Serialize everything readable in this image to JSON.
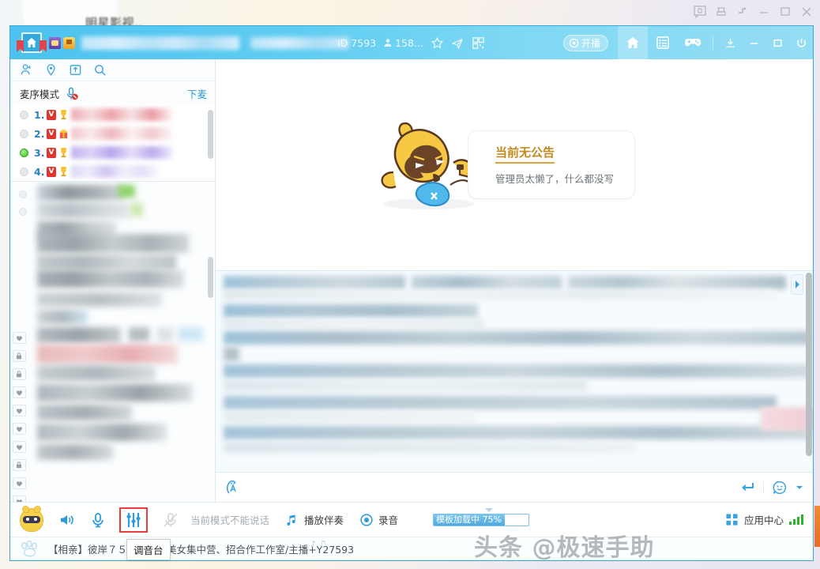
{
  "desktop": {
    "background_title": "明星影视..",
    "window_buttons": [
      "feedback-icon",
      "hat-icon",
      "pin-icon",
      "minimize-icon",
      "maximize-icon",
      "close-icon"
    ]
  },
  "header": {
    "room_id_label": "ID 7593",
    "viewer_count": "158...",
    "icons": [
      "person-icon",
      "star-icon",
      "plane-icon",
      "qrcode-icon"
    ],
    "live_button": "开播",
    "tabs": [
      "home-icon",
      "list-icon",
      "gamepad-icon"
    ],
    "window_controls": [
      "download-icon",
      "minimize-icon",
      "maximize-icon",
      "power-icon"
    ]
  },
  "left_panel": {
    "toolbar_icons": [
      "person-add-icon",
      "location-icon",
      "expand-icon",
      "search-icon"
    ],
    "mic_mode_label": "麦序模式",
    "mic_muted_icon": "mic-muted-icon",
    "leave_mic_label": "下麦",
    "mic_rows": [
      {
        "index": "1.",
        "badge": "V",
        "rank": "trophy-icon",
        "active": false,
        "tone": "#f0b8bd"
      },
      {
        "index": "2.",
        "badge": "V",
        "rank": "gift-icon",
        "active": false,
        "tone": "#f2c6ca"
      },
      {
        "index": "3.",
        "badge": "V",
        "rank": "trophy-icon",
        "active": true,
        "tone": "#c5b9ee"
      },
      {
        "index": "4.",
        "badge": "V",
        "rank": "trophy-icon",
        "active": false,
        "tone": "#d6cdf2"
      }
    ],
    "edge_icons": [
      "heart-icon",
      "lock-icon",
      "lock-icon",
      "heart-icon",
      "heart-icon",
      "heart-icon",
      "heart-icon",
      "lock-icon",
      "heart-icon",
      "heart-icon"
    ]
  },
  "notice": {
    "mascot": "raccoon-mascot",
    "title": "当前无公告",
    "subtitle": "管理员太懒了，什么都没写"
  },
  "chat": {
    "scroll_arrow": "right-arrow-icon",
    "input_icon": "font-style-icon",
    "send_icon": "enter-icon",
    "emoji_icon": "emoji-icon",
    "dropdown_icon": "chevron-down-icon"
  },
  "bottom_bar": {
    "avatar": "cat-avatar",
    "speaker_icon": "speaker-icon",
    "mic_icon": "microphone-icon",
    "equalizer_icon": "equalizer-icon",
    "equalizer_highlighted": true,
    "mute_notice_icon": "mic-muted-icon",
    "mute_notice_text": "当前模式不能说话",
    "accompaniment_icon": "music-note-icon",
    "accompaniment_label": "播放伴奏",
    "record_icon": "record-icon",
    "record_label": "录音",
    "progress_text": "模板加载中 75%",
    "progress_percent": 75,
    "app_center_icon": "grid-icon",
    "app_center_label": "应用中心",
    "signal_icon": "signal-bars-icon"
  },
  "status_bar": {
    "paw_icon": "paw-icon",
    "text": "【相亲】彼岸７５９３拉：美女集中营、招合作工作室/主播+Y27593"
  },
  "tooltip": {
    "text": "调音台"
  },
  "watermark": {
    "text": "头条 @极速手助"
  },
  "colors": {
    "header_blue": "#5fcdf2",
    "accent_blue": "#2d9bd8",
    "highlight_red": "#ee3b3b",
    "notice_gold": "#c08a1e",
    "signal_green": "#2cb32c"
  }
}
